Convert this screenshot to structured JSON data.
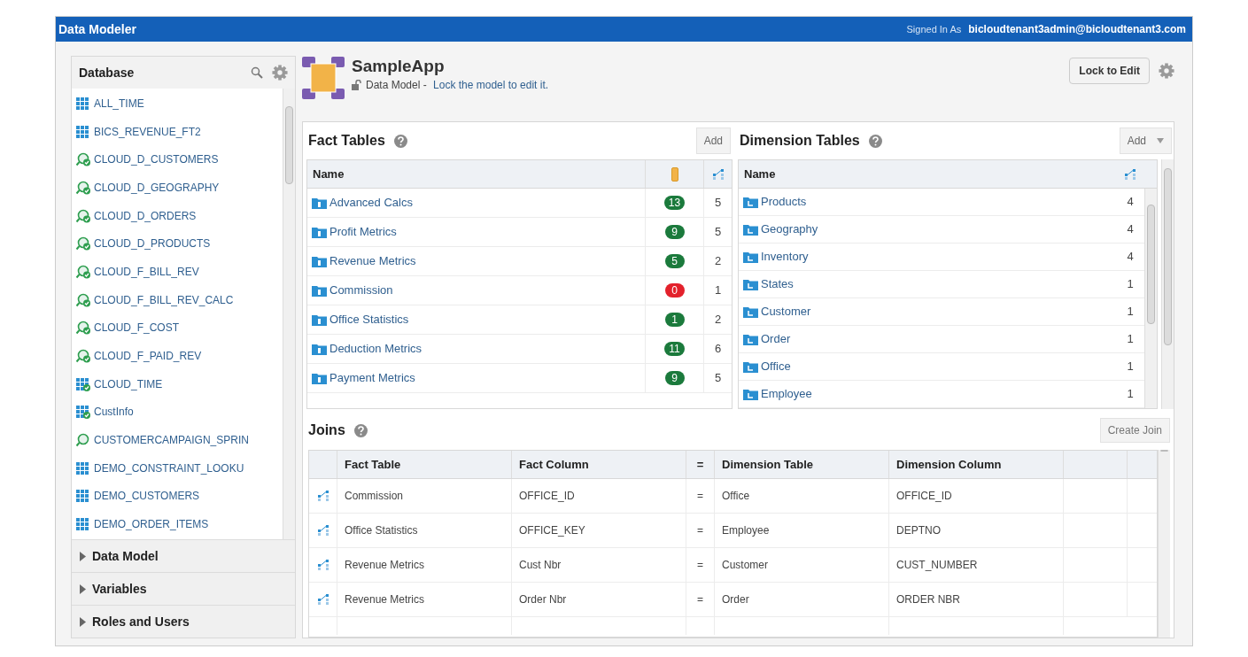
{
  "header": {
    "title": "Data Modeler",
    "signed_in_label": "Signed In As",
    "user": "bicloudtenant3admin@bicloudtenant3.com"
  },
  "database": {
    "title": "Database",
    "items": [
      {
        "name": "ALL_TIME",
        "kind": "table"
      },
      {
        "name": "BICS_REVENUE_FT2",
        "kind": "table"
      },
      {
        "name": "CLOUD_D_CUSTOMERS",
        "kind": "source_check"
      },
      {
        "name": "CLOUD_D_GEOGRAPHY",
        "kind": "source_check"
      },
      {
        "name": "CLOUD_D_ORDERS",
        "kind": "source_check"
      },
      {
        "name": "CLOUD_D_PRODUCTS",
        "kind": "source_check"
      },
      {
        "name": "CLOUD_F_BILL_REV",
        "kind": "source_check"
      },
      {
        "name": "CLOUD_F_BILL_REV_CALC",
        "kind": "source_check"
      },
      {
        "name": "CLOUD_F_COST",
        "kind": "source_check"
      },
      {
        "name": "CLOUD_F_PAID_REV",
        "kind": "source_check"
      },
      {
        "name": "CLOUD_TIME",
        "kind": "table_check"
      },
      {
        "name": "CustInfo",
        "kind": "table_check"
      },
      {
        "name": "CUSTOMERCAMPAIGN_SPRIN",
        "kind": "source"
      },
      {
        "name": "DEMO_CONSTRAINT_LOOKU",
        "kind": "table"
      },
      {
        "name": "DEMO_CUSTOMERS",
        "kind": "table"
      },
      {
        "name": "DEMO_ORDER_ITEMS",
        "kind": "table"
      }
    ]
  },
  "sections": [
    {
      "label": "Data Model",
      "expanded": false
    },
    {
      "label": "Variables",
      "expanded": false
    },
    {
      "label": "Roles and Users",
      "expanded": false
    }
  ],
  "model": {
    "name": "SampleApp",
    "subtitle": "Data Model - ",
    "link": "Lock the model to edit it.",
    "lock_button": "Lock to Edit"
  },
  "fact_tables": {
    "title": "Fact Tables",
    "add": "Add",
    "name_column": "Name",
    "rows": [
      {
        "name": "Advanced Calcs",
        "measures": "13",
        "color": "#1b7a3c",
        "joins": "5"
      },
      {
        "name": "Profit Metrics",
        "measures": "9",
        "color": "#1b7a3c",
        "joins": "5"
      },
      {
        "name": "Revenue Metrics",
        "measures": "5",
        "color": "#1b7a3c",
        "joins": "2"
      },
      {
        "name": "Commission",
        "measures": "0",
        "color": "#e3212b",
        "joins": "1"
      },
      {
        "name": "Office Statistics",
        "measures": "1",
        "color": "#1b7a3c",
        "joins": "2"
      },
      {
        "name": "Deduction Metrics",
        "measures": "11",
        "color": "#1b7a3c",
        "joins": "6"
      },
      {
        "name": "Payment Metrics",
        "measures": "9",
        "color": "#1b7a3c",
        "joins": "5"
      }
    ]
  },
  "dimension_tables": {
    "title": "Dimension Tables",
    "add": "Add",
    "name_column": "Name",
    "rows": [
      {
        "name": "Products",
        "joins": "4"
      },
      {
        "name": "Geography",
        "joins": "4"
      },
      {
        "name": "Inventory",
        "joins": "4"
      },
      {
        "name": "States",
        "joins": "1"
      },
      {
        "name": "Customer",
        "joins": "1"
      },
      {
        "name": "Order",
        "joins": "1"
      },
      {
        "name": "Office",
        "joins": "1"
      },
      {
        "name": "Employee",
        "joins": "1"
      }
    ]
  },
  "joins": {
    "title": "Joins",
    "create": "Create Join",
    "columns": [
      "Fact Table",
      "Fact Column",
      "=",
      "Dimension Table",
      "Dimension Column"
    ],
    "rows": [
      [
        "Commission",
        "OFFICE_ID",
        "=",
        "Office",
        "OFFICE_ID"
      ],
      [
        "Office Statistics",
        "OFFICE_KEY",
        "=",
        "Employee",
        "DEPTNO"
      ],
      [
        "Revenue Metrics",
        "Cust Nbr",
        "=",
        "Customer",
        "CUST_NUMBER"
      ],
      [
        "Revenue Metrics",
        "Order Nbr",
        "=",
        "Order",
        "ORDER NBR"
      ]
    ]
  }
}
